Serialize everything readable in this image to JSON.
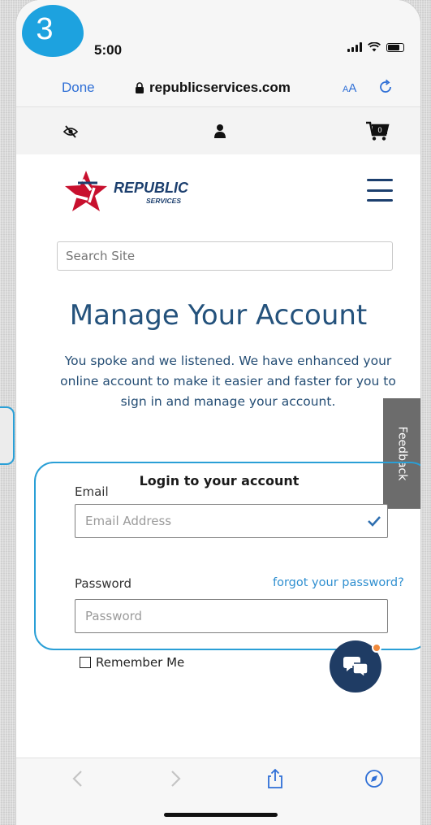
{
  "step": {
    "number": "3"
  },
  "status_bar": {
    "time": "5:00"
  },
  "browser": {
    "done_label": "Done",
    "url": "republicservices.com",
    "aa_small": "A",
    "aa_large": "A"
  },
  "utility": {
    "cart_count": "0"
  },
  "header": {
    "brand": "REPUBLIC",
    "brand_sub": "SERVICES"
  },
  "search": {
    "placeholder": "Search Site"
  },
  "main": {
    "title": "Manage Your Account",
    "intro": "You spoke and we listened. We have enhanced your online account to make it easier and faster for you to sign in and manage your account."
  },
  "feedback_label": "Feedback",
  "login": {
    "heading": "Login to your account",
    "email_label": "Email",
    "email_placeholder": "Email Address",
    "password_label": "Password",
    "password_placeholder": "Password",
    "forgot_label": "forgot your password?",
    "remember_label": "Remember Me"
  },
  "colors": {
    "accent": "#2a9fd6",
    "brand_navy": "#1c3f6e",
    "brand_red": "#c8102e",
    "link": "#2f8fd0"
  }
}
